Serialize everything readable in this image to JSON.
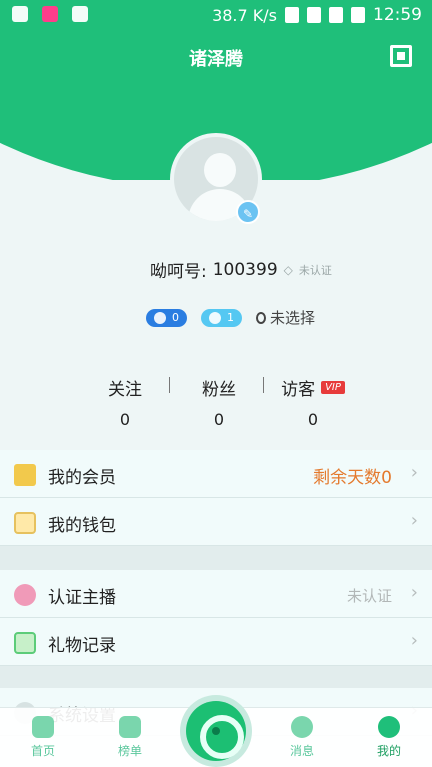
{
  "status_bar": {
    "speed": "38.7 K/s",
    "time": "12:59"
  },
  "header": {
    "title": "诸泽腾"
  },
  "profile": {
    "id_label": "呦呵号:",
    "id_value": "100399",
    "verify_small": "未认证",
    "gender_count": "0",
    "message_count": "1",
    "location": "未选择"
  },
  "stats": {
    "follow_label": "关注",
    "follow_value": "0",
    "fans_label": "粉丝",
    "fans_value": "0",
    "visitors_label": "访客",
    "visitors_value": "0",
    "vip_badge": "VIP"
  },
  "menu": {
    "member_label": "我的会员",
    "member_right": "剩余天数0",
    "wallet_label": "我的钱包",
    "anchor_label": "认证主播",
    "anchor_right": "未认证",
    "gifts_label": "礼物记录",
    "settings_label": "系统设置"
  },
  "bottom_nav": {
    "home": "首页",
    "rank": "榜单",
    "messages": "消息",
    "mine": "我的"
  },
  "colors": {
    "brand": "#1fbf7a",
    "member_right": "#e47a2e",
    "vip": "#e73b3b"
  }
}
